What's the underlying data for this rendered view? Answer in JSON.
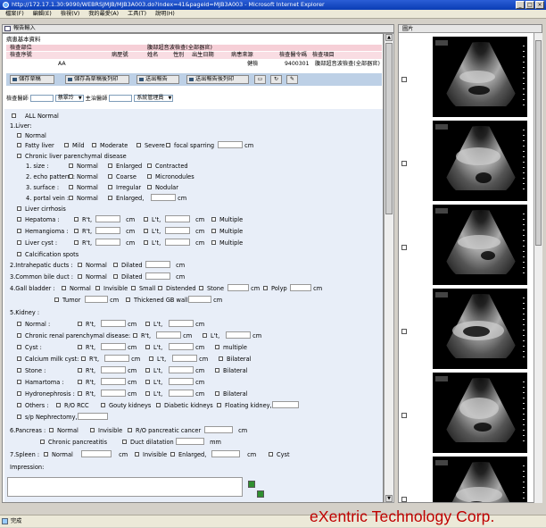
{
  "window": {
    "title": "http://172.17.1.30:9090/WEBRSJMJB/MJB3A003.do?index=41&pageid=MJB3A003 - Microsoft Internet Explorer"
  },
  "menu": [
    "檔案(F)",
    "編輯(E)",
    "檢視(V)",
    "我的最愛(A)",
    "工具(T)",
    "說明(H)"
  ],
  "tab": {
    "label": "報告輸入"
  },
  "section": {
    "title": "病患基本資料"
  },
  "patient": {
    "header1": "檢查部位",
    "header2": "腹部超音波檢查(全部器官)",
    "cols": [
      "檢查序號",
      "病歷號",
      "姓名",
      "性別",
      "出生日期",
      "病患來源",
      "檢查醫令碼",
      "檢查項目"
    ],
    "row": {
      "id": "AA",
      "source": "健檢",
      "order": "9400301",
      "item": "腹部超音波檢查(全部器官)"
    }
  },
  "toolbar": {
    "b1": "儲存草稿",
    "b2": "儲存為草稿後列印",
    "b3": "送出報告",
    "b4": "送出報告後列印"
  },
  "docs": {
    "label1": "檢查醫師",
    "sel1": "蔡翠玲",
    "label2": "主治醫師",
    "sel2": "系統管理員"
  },
  "form": {
    "all_normal": "ALL Normal",
    "liver": "1.Liver:",
    "normal": "Normal",
    "fatty": "Fatty liver",
    "mild": "Mild",
    "moderate": "Moderate",
    "severe": "Severe",
    "focal": "focal sparring",
    "cm": "cm",
    "chronic": "Chronic liver parenchymal disease",
    "size": "1. size :",
    "enlarged": "Enlarged",
    "contracted": "Contracted",
    "echo": "2. echo pattern :",
    "coarse": "Coarse",
    "micronodules": "Micronodules",
    "surface": "3. surface :",
    "irregular": "Irregular",
    "nodular": "Nodular",
    "portal": "4. portal vein :",
    "enlarged2": "Enlarged,",
    "cirrhosis": "Liver cirrhosis",
    "hepatoma": "Hepatoma :",
    "rt": "R't,",
    "lt": "L't,",
    "multiple": "Multiple",
    "multiple_lc": "multiple",
    "hemangioma": "Hemangioma :",
    "cyst": "Liver cyst :",
    "calc": "Calcification spots",
    "ihd": "2.Intrahepatic ducts :",
    "dilated": "Dilated",
    "cbd": "3.Common bile duct :",
    "gb": "4.Gall bladder :",
    "invisible": "Invisible",
    "small": "Small",
    "distended": "Distended",
    "stone": "Stone",
    "polyp": "Polyp",
    "tumor": "Tumor",
    "thickened": "Thickened GB wall",
    "kidney": "5.Kidney :",
    "normal2": "Normal :",
    "crpd": "Chronic renal parenchymal disease:",
    "cyst2": "Cyst :",
    "calcium": "Calcium milk cyst:",
    "bilateral": "Bilateral",
    "stone2": "Stone :",
    "hamartoma": "Hamartoma :",
    "hydro": "Hydronephrosis :",
    "others": "Others :",
    "rorcc": "R/O RCC",
    "gouty": "Gouty kidneys",
    "diabetic": "Diabetic kidneys",
    "floating": "Floating kidney,",
    "sp": "s/p Nephrectomy,",
    "pancreas": "6.Pancreas :",
    "rocancer": "R/O pancreatic cancer",
    "chronicpanc": "Chronic pancreatitis",
    "ductdil": "Duct dilatation",
    "mm": "mm",
    "spleen": "7.Spleen :",
    "cyst3": "Cyst",
    "impression": "Impression:"
  },
  "images": {
    "header": "圖片"
  },
  "status": {
    "text": "完成"
  },
  "brand": "eXentric Technology Corp."
}
